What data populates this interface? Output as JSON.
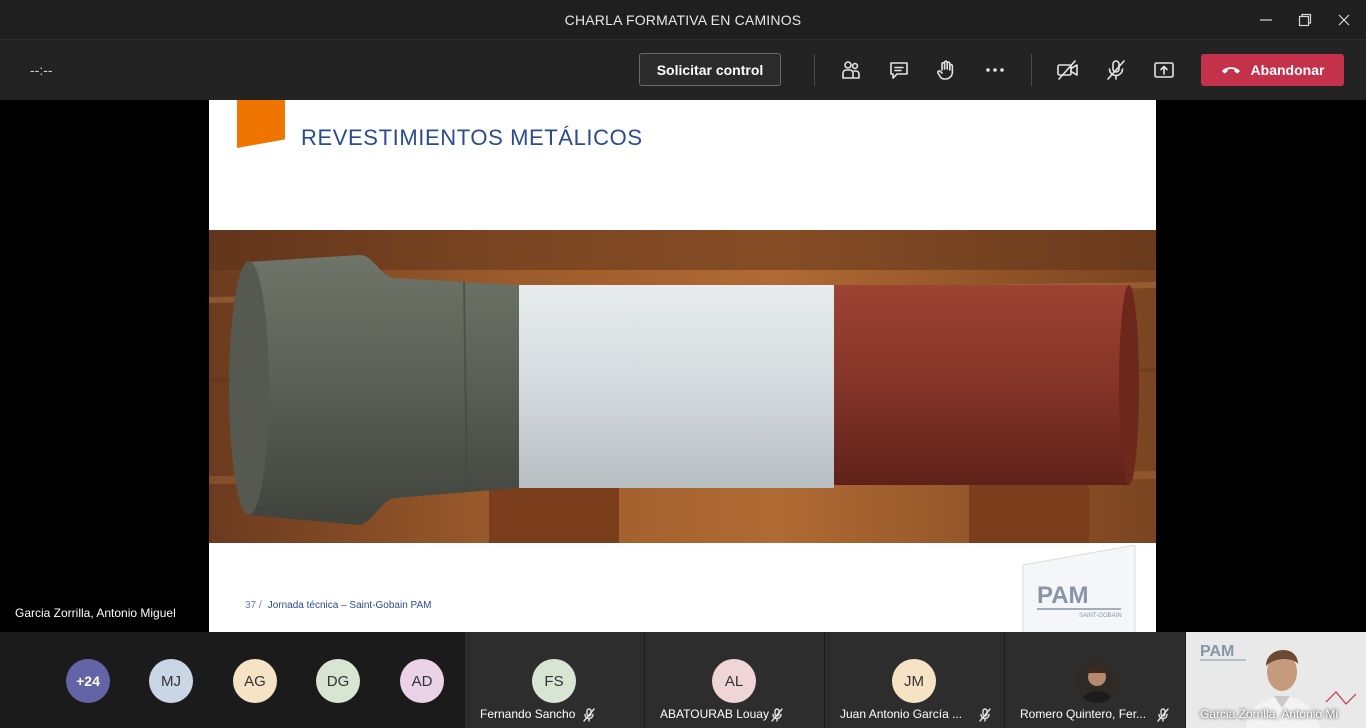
{
  "window": {
    "title": "CHARLA FORMATIVA EN CAMINOS"
  },
  "toolbar": {
    "timer": "--:--",
    "request_control_label": "Solicitar control",
    "leave_label": "Abandonar"
  },
  "slide": {
    "title": "REVESTIMIENTOS  METÁLICOS",
    "page_number": "37 /",
    "footer": "Jornada técnica – Saint-Gobain PAM",
    "logo_text": "PAM",
    "logo_sub": "SAINT-GOBAIN"
  },
  "presenter_name": "Garcia Zorrilla, Antonio Miguel",
  "participants": {
    "overflow_count": "+24",
    "avatars": [
      {
        "initials": "MJ",
        "color": "#c9d6e6"
      },
      {
        "initials": "AG",
        "color": "#f6e3c5"
      },
      {
        "initials": "DG",
        "color": "#d9e5d3"
      },
      {
        "initials": "AD",
        "color": "#ead3e6"
      }
    ],
    "tiles": [
      {
        "initials": "FS",
        "name": "Fernando Sancho",
        "color": "#d9e5d3"
      },
      {
        "initials": "AL",
        "name": "ABATOURAB Louay",
        "color": "#efd5d5"
      },
      {
        "initials": "JM",
        "name": "Juan Antonio García ...",
        "color": "#f6e3c5"
      },
      {
        "initials": "",
        "name": "Romero Quintero, Fer..."
      }
    ],
    "video_tile": {
      "name": "Garcia Zorrilla, Antonio Mi",
      "logo_text": "PAM"
    }
  },
  "colors": {
    "accent_orange": "#f07400",
    "slide_title": "#2a4c8f",
    "leave_red": "#c4314b",
    "overflow_avatar": "#6264a7"
  },
  "icons": [
    "minimize-icon",
    "restore-icon",
    "close-icon",
    "participants-icon",
    "chat-icon",
    "raise-hand-icon",
    "more-options-icon",
    "camera-off-icon",
    "mic-off-icon",
    "share-tray-icon",
    "phone-hangup-icon"
  ]
}
